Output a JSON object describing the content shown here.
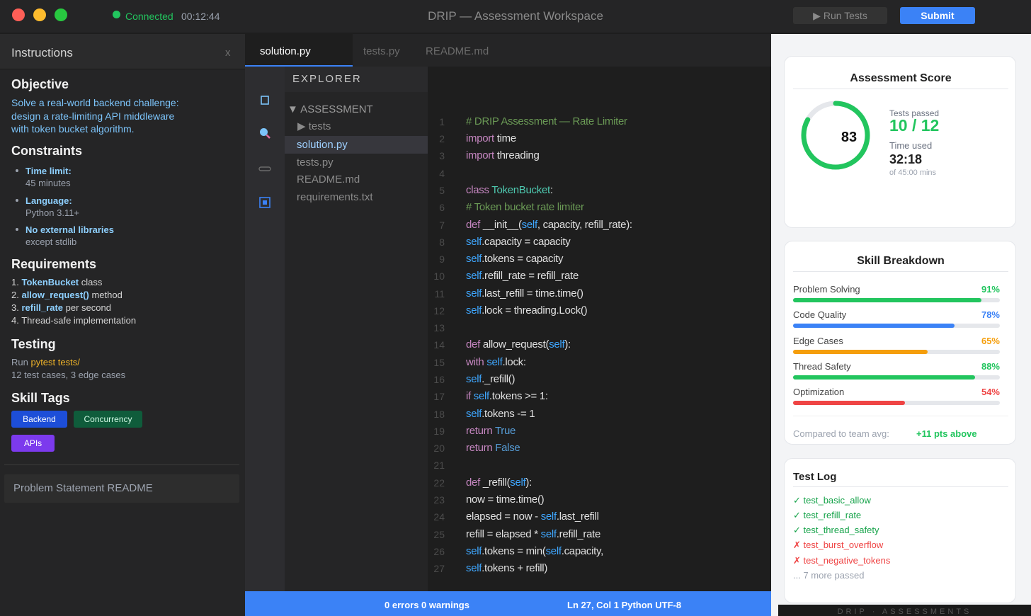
{
  "titlebar": {
    "status": "Connected",
    "timer": "00:12:44",
    "title": "DRIP — Assessment Workspace",
    "run_tests": "▶ Run Tests",
    "submit": "Submit"
  },
  "instructions": {
    "header": "Instructions",
    "close": "x",
    "objective_title": "Objective",
    "objective_lines": [
      "Solve a real-world backend challenge:",
      "design a rate-limiting API middleware",
      "with token bucket algorithm."
    ],
    "constraints_title": "Constraints",
    "constraints": [
      {
        "main": "Time limit:",
        "sub": "45 minutes"
      },
      {
        "main": "Language:",
        "sub": "Python 3.11+"
      },
      {
        "main": "No external libraries",
        "sub": "except stdlib"
      }
    ],
    "requirements_title": "Requirements",
    "requirements": [
      {
        "num": "1. ",
        "bold": "TokenBucket",
        "rest": " class"
      },
      {
        "num": "2. ",
        "bold": "allow_request()",
        "rest": " method"
      },
      {
        "num": "3. ",
        "bold": "refill_rate",
        "rest": " per second"
      },
      {
        "num": "4. ",
        "bold": "",
        "rest": "Thread-safe implementation"
      }
    ],
    "testing_title": "Testing",
    "testing_run": "Run ",
    "testing_cmd": "pytest tests/",
    "testing_desc": "12 test cases, 3 edge cases",
    "skill_tags_title": "Skill Tags",
    "tags": [
      "Backend",
      "Concurrency",
      "APIs"
    ],
    "readme_button": "Problem Statement README"
  },
  "editor": {
    "tabs": [
      "solution.py",
      "tests.py",
      "README.md"
    ],
    "explorer_title": "EXPLORER",
    "explorer_items": [
      "▼ ASSESSMENT",
      "▶ tests",
      "solution.py",
      "tests.py",
      "README.md",
      "requirements.txt"
    ],
    "line_numbers": [
      "1",
      "2",
      "3",
      "4",
      "5",
      "6",
      "7",
      "8",
      "9",
      "10",
      "11",
      "12",
      "13",
      "14",
      "15",
      "16",
      "17",
      "18",
      "19",
      "20",
      "21",
      "22",
      "23",
      "24",
      "25",
      "26",
      "27"
    ],
    "status_left": "0 errors 0 warnings",
    "status_right": "Ln 27, Col 1 Python UTF-8"
  },
  "score": {
    "title": "Assessment Score",
    "value": "83",
    "value_fraction": 0.83,
    "tests_passed_label": "Tests passed",
    "tests_passed": "10 / 12",
    "time_used_label": "Time used",
    "time_used": "32:18",
    "time_total": "of 45:00 mins"
  },
  "skills": {
    "title": "Skill Breakdown",
    "items": [
      {
        "label": "Problem Solving",
        "value": "91%",
        "fraction": 0.91,
        "color": "#22c55e"
      },
      {
        "label": "Code Quality",
        "value": "78%",
        "fraction": 0.78,
        "color": "#3b82f6"
      },
      {
        "label": "Edge Cases",
        "value": "65%",
        "fraction": 0.65,
        "color": "#f59e0b"
      },
      {
        "label": "Thread Safety",
        "value": "88%",
        "fraction": 0.88,
        "color": "#22c55e"
      },
      {
        "label": "Optimization",
        "value": "54%",
        "fraction": 0.54,
        "color": "#ef4444"
      }
    ],
    "compare_label": "Compared to team avg:",
    "compare_value": "+11 pts above"
  },
  "test_log": {
    "title": "Test Log",
    "items": [
      {
        "text": "✓ test_basic_allow",
        "color": "#16a34a"
      },
      {
        "text": "✓ test_refill_rate",
        "color": "#16a34a"
      },
      {
        "text": "✓ test_thread_safety",
        "color": "#16a34a"
      },
      {
        "text": "✗ test_burst_overflow",
        "color": "#ef4444"
      },
      {
        "text": "✗ test_negative_tokens",
        "color": "#ef4444"
      },
      {
        "text": "... 7 more passed",
        "color": "#9ca3af"
      }
    ]
  },
  "footer": "DRIP · ASSESSMENTS",
  "colors": {
    "accent": "#3b82f6",
    "success": "#22c55e",
    "error": "#ef4444"
  }
}
